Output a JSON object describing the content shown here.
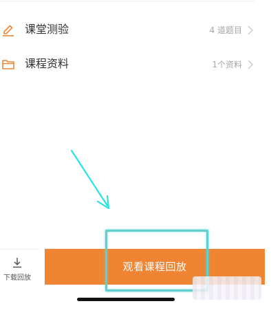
{
  "course_items": [
    {
      "label": "课堂测验",
      "meta": "4 道题目",
      "icon": "pencil-icon"
    },
    {
      "label": "课程资料",
      "meta": "1个资料",
      "icon": "folder-icon"
    }
  ],
  "bottom_bar": {
    "download_label": "下载回放",
    "watch_label": "观看课程回放"
  },
  "colors": {
    "accent": "#ef8532",
    "annotation": "#27e3e3",
    "highlight": "#5fcfd0"
  }
}
